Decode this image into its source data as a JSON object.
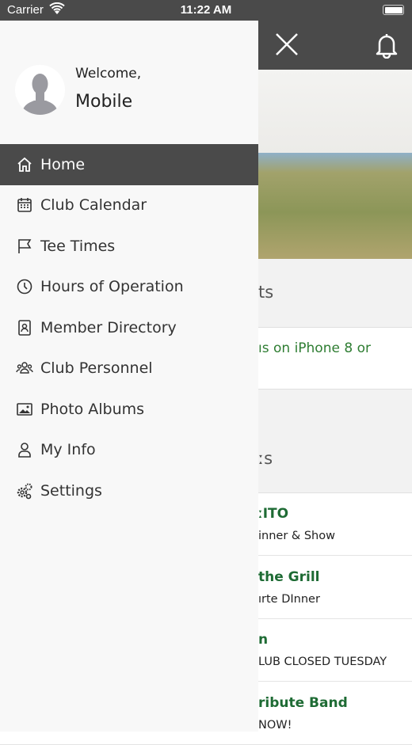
{
  "status": {
    "carrier": "Carrier",
    "time": "11:22 AM"
  },
  "background": {
    "section1": "ts",
    "notice": "ıs on iPhone 8 or",
    "section2": "ːs",
    "events": [
      {
        "title": "ːITO",
        "subtitle": "inner & Show"
      },
      {
        "title": "the Grill",
        "subtitle": "ırte DInner"
      },
      {
        "title": "n",
        "subtitle": "LUB CLOSED TUESDAY"
      },
      {
        "title": "ribute Band",
        "subtitle": "NOW!"
      }
    ]
  },
  "drawer": {
    "welcome": "Welcome,",
    "username": "Mobile",
    "items": [
      {
        "label": "Home",
        "icon": "home-icon",
        "active": true
      },
      {
        "label": "Club Calendar",
        "icon": "calendar-icon"
      },
      {
        "label": "Tee Times",
        "icon": "flag-icon"
      },
      {
        "label": "Hours of Operation",
        "icon": "clock-icon"
      },
      {
        "label": "Member Directory",
        "icon": "contacts-icon"
      },
      {
        "label": "Club Personnel",
        "icon": "group-icon"
      },
      {
        "label": "Photo Albums",
        "icon": "photo-icon"
      },
      {
        "label": "My Info",
        "icon": "user-icon"
      },
      {
        "label": "Settings",
        "icon": "gears-icon"
      }
    ]
  },
  "colors": {
    "header": "#4a4a4a",
    "accent": "#1e6b34"
  }
}
